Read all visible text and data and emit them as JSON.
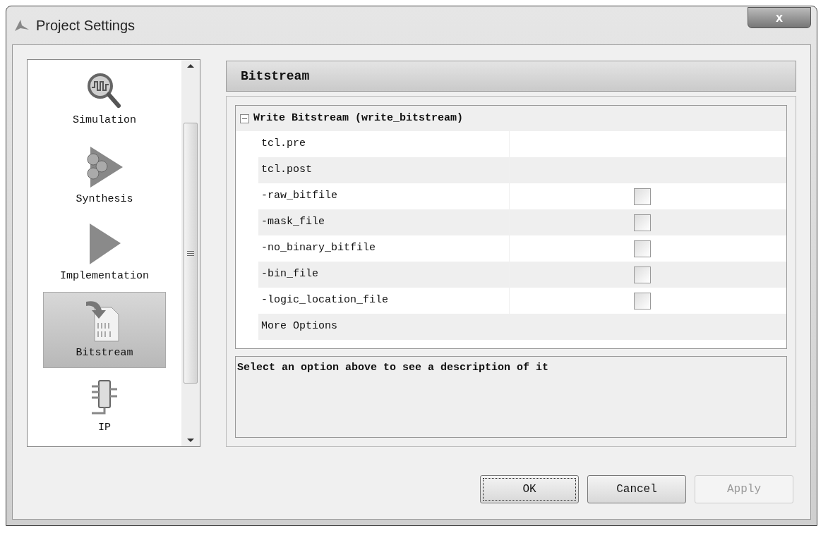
{
  "window": {
    "title": "Project Settings",
    "close": "x"
  },
  "sidebar": {
    "items": [
      {
        "label": "Simulation",
        "kind": "simulation",
        "selected": false
      },
      {
        "label": "Synthesis",
        "kind": "synthesis",
        "selected": false
      },
      {
        "label": "Implementation",
        "kind": "implementation",
        "selected": false
      },
      {
        "label": "Bitstream",
        "kind": "bitstream",
        "selected": true
      },
      {
        "label": "IP",
        "kind": "ip",
        "selected": false
      }
    ]
  },
  "panel": {
    "title": "Bitstream",
    "group": {
      "label": "Write Bitstream (write_bitstream)",
      "expanded": true,
      "rows": [
        {
          "kind": "text",
          "name": "tcl.pre"
        },
        {
          "kind": "text",
          "name": "tcl.post"
        },
        {
          "kind": "checkbox",
          "name": "-raw_bitfile",
          "checked": false
        },
        {
          "kind": "checkbox",
          "name": "-mask_file",
          "checked": false
        },
        {
          "kind": "checkbox",
          "name": "-no_binary_bitfile",
          "checked": false
        },
        {
          "kind": "checkbox",
          "name": "-bin_file",
          "checked": false
        },
        {
          "kind": "checkbox",
          "name": "-logic_location_file",
          "checked": false
        },
        {
          "kind": "more",
          "name": "More Options"
        }
      ]
    },
    "description": "Select an option above to see a description of it"
  },
  "buttons": [
    {
      "label": "OK",
      "disabled": false,
      "focused": true
    },
    {
      "label": "Cancel",
      "disabled": false,
      "focused": false
    },
    {
      "label": "Apply",
      "disabled": true,
      "focused": false
    }
  ]
}
